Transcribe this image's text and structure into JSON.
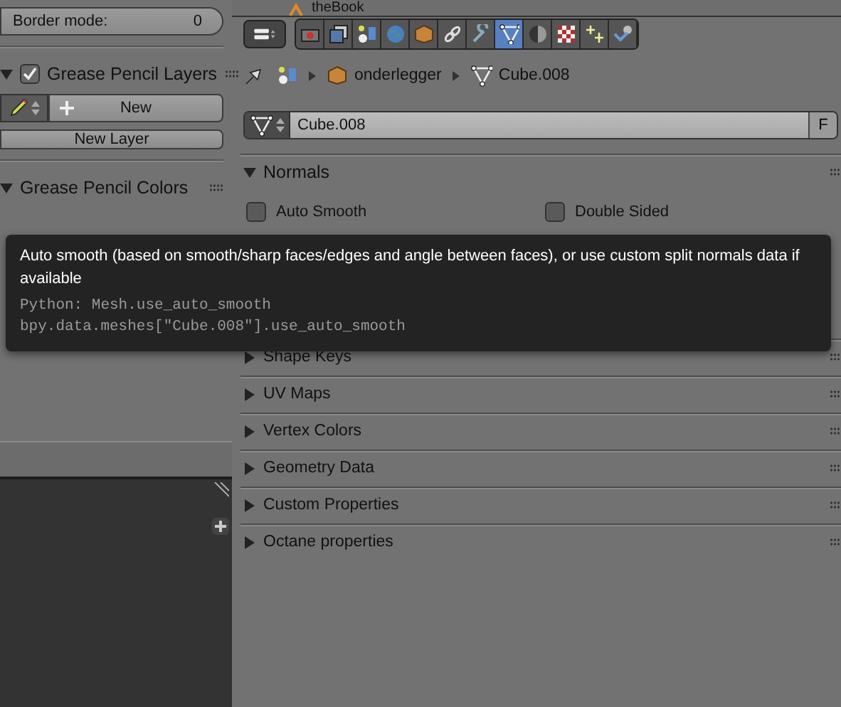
{
  "left_panel": {
    "border_mode": {
      "label": "Border mode:",
      "value": "0"
    },
    "layers_panel": {
      "title": "Grease Pencil Layers",
      "checked": true,
      "expanded": true,
      "new_button": "New",
      "new_layer_button": "New Layer"
    },
    "colors_panel": {
      "title": "Grease Pencil Colors",
      "expanded": true
    }
  },
  "top_header": {
    "label": "theBook"
  },
  "properties": {
    "tabs": [
      {
        "selected": false
      },
      {
        "selected": false
      },
      {
        "selected": false
      },
      {
        "selected": false
      },
      {
        "selected": false
      },
      {
        "selected": false
      },
      {
        "selected": false
      },
      {
        "selected": true
      },
      {
        "selected": false
      },
      {
        "selected": false
      },
      {
        "selected": false
      },
      {
        "selected": false
      }
    ],
    "breadcrumb": [
      "onderlegger",
      "Cube.008"
    ],
    "datablock": {
      "value": "Cube.008",
      "fake_user": "F"
    },
    "normals": {
      "title": "Normals",
      "expanded": true,
      "options": [
        {
          "label": "Auto Smooth",
          "checked": false
        },
        {
          "label": "Double Sided",
          "checked": false
        }
      ]
    },
    "panels": [
      {
        "title": "Shape Keys",
        "expanded": false
      },
      {
        "title": "UV Maps",
        "expanded": false
      },
      {
        "title": "Vertex Colors",
        "expanded": false
      },
      {
        "title": "Geometry Data",
        "expanded": false
      },
      {
        "title": "Custom Properties",
        "expanded": false
      },
      {
        "title": "Octane properties",
        "expanded": false
      }
    ]
  },
  "tooltip": {
    "description": "Auto smooth (based on smooth/sharp faces/edges and angle between faces), or use custom split normals data if available",
    "python": [
      "Python: Mesh.use_auto_smooth",
      "bpy.data.meshes[\"Cube.008\"].use_auto_smooth"
    ]
  }
}
